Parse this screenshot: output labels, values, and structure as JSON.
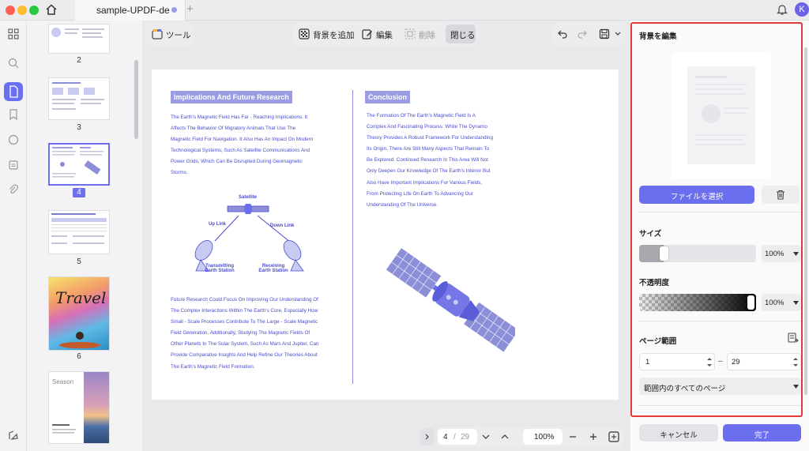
{
  "titlebar": {
    "title": "sample-UPDF-de",
    "plus": "+",
    "avatar": "K"
  },
  "thumbnails": [
    {
      "num": "2"
    },
    {
      "num": "3"
    },
    {
      "num": "4"
    },
    {
      "num": "5"
    },
    {
      "num": "6"
    }
  ],
  "thumb_texts": {
    "travel": "Travel",
    "season": "Season"
  },
  "toolbar": {
    "tools": "ツール",
    "add_background": "背景を追加",
    "edit": "編集",
    "delete": "削除",
    "close": "閉じる"
  },
  "document": {
    "left_heading": "Implications And Future Research",
    "left_body": [
      "The Earth's Magnetic Field Has Far - Reaching Implications. It",
      "Affects The Behavior Of Migratory Animals That Use The",
      "Magnetic Field For Navigation. It Also Has An Impact On Modern",
      "Technological Systems, Such As Satellite Communications And",
      "Power Grids, Which Can Be Disrupted During Geomagnetic",
      "Storms."
    ],
    "diagram": {
      "satellite": "Satellite",
      "up_link": "Up Link",
      "down_link": "Down Link",
      "transmitting_1": "Transmitting",
      "transmitting_2": "Earth Station",
      "receiving_1": "Receiving",
      "receiving_2": "Earth Station"
    },
    "left_body2": [
      "Future Research Could Focus On Improving Our Understanding Of",
      "The Complex Interactions Within The Earth's Core, Especially How",
      "Small - Scale Processes Contribute To The Large - Scale Magnetic",
      "Field Generation. Additionally, Studying The Magnetic Fields Of",
      "Other Planets In The Solar System, Such As Mars And Jupiter, Can",
      "Provide Comparative Insights And Help Refine Our Theories About",
      "The Earth's Magnetic Field Formation."
    ],
    "right_heading": "Conclusion",
    "right_body": [
      "The Formation Of The Earth's Magnetic Field Is A",
      "Complex And Fascinating Process. While The Dynamo",
      "Theory Provides A Robust Framework For Understanding",
      "Its Origin, There Are Still Many Aspects That Remain To",
      "Be Explored. Continued Research In This Area Will Not",
      "Only Deepen Our Knowledge Of The Earth's Interior But",
      "Also Have Important Implications For Various Fields,",
      "From Protecting Life On Earth To Advancing Our",
      "Understanding Of The Universe."
    ]
  },
  "pager": {
    "current": "4",
    "separator": "/",
    "total": "29",
    "zoom": "100%"
  },
  "panel": {
    "title": "背景を編集",
    "choose_file": "ファイルを選択",
    "size_label": "サイズ",
    "size_value": "100%",
    "size_level": 0.17,
    "opacity_label": "不透明度",
    "opacity_value": "100%",
    "opacity_level": 1.0,
    "page_range_label": "ページ範囲",
    "range_from": "1",
    "range_to": "29",
    "range_dash": "–",
    "range_option": "範囲内のすべてのページ",
    "cancel": "キャンセル",
    "done": "完了"
  },
  "colors": {
    "accent": "#6c6ef0",
    "doc_text": "#4a4cd0",
    "highlight": "#e23a3a"
  }
}
